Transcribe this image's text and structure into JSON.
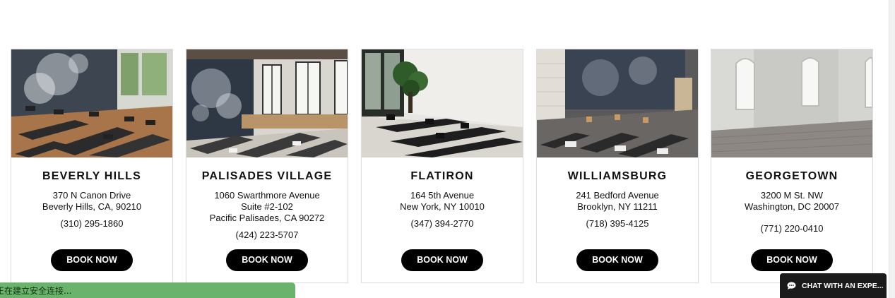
{
  "locations": [
    {
      "name": "BEVERLY HILLS",
      "address_lines": [
        "370 N Canon Drive",
        "Beverly Hills, CA, 90210"
      ],
      "phone": "(310) 295-1860",
      "button": "BOOK NOW"
    },
    {
      "name": "PALISADES VILLAGE",
      "address_lines": [
        "1060 Swarthmore Avenue",
        "Suite #2-102",
        "Pacific Palisades, CA 90272"
      ],
      "phone": "(424) 223-5707",
      "button": "BOOK NOW"
    },
    {
      "name": "FLATIRON",
      "address_lines": [
        "164 5th Avenue",
        "New York, NY 10010"
      ],
      "phone": "(347) 394-2770",
      "button": "BOOK NOW"
    },
    {
      "name": "WILLIAMSBURG",
      "address_lines": [
        "241 Bedford Avenue",
        "Brooklyn, NY 11211"
      ],
      "phone": "(718) 395-4125",
      "button": "BOOK NOW"
    },
    {
      "name": "GEORGETOWN",
      "address_lines": [
        "3200 M St. NW",
        "Washington, DC 20007"
      ],
      "phone": "(771) 220-0410",
      "button": "BOOK NOW"
    }
  ],
  "status_bar": {
    "text": "正在建立安全连接..."
  },
  "chat": {
    "label": "CHAT WITH AN EXPE...",
    "icon": "chat-bubble-icon"
  },
  "colors": {
    "button_bg": "#000000",
    "status_bar_bg": "#6ab36d",
    "chat_bg": "#1b1b1b",
    "card_border": "#dedede"
  }
}
